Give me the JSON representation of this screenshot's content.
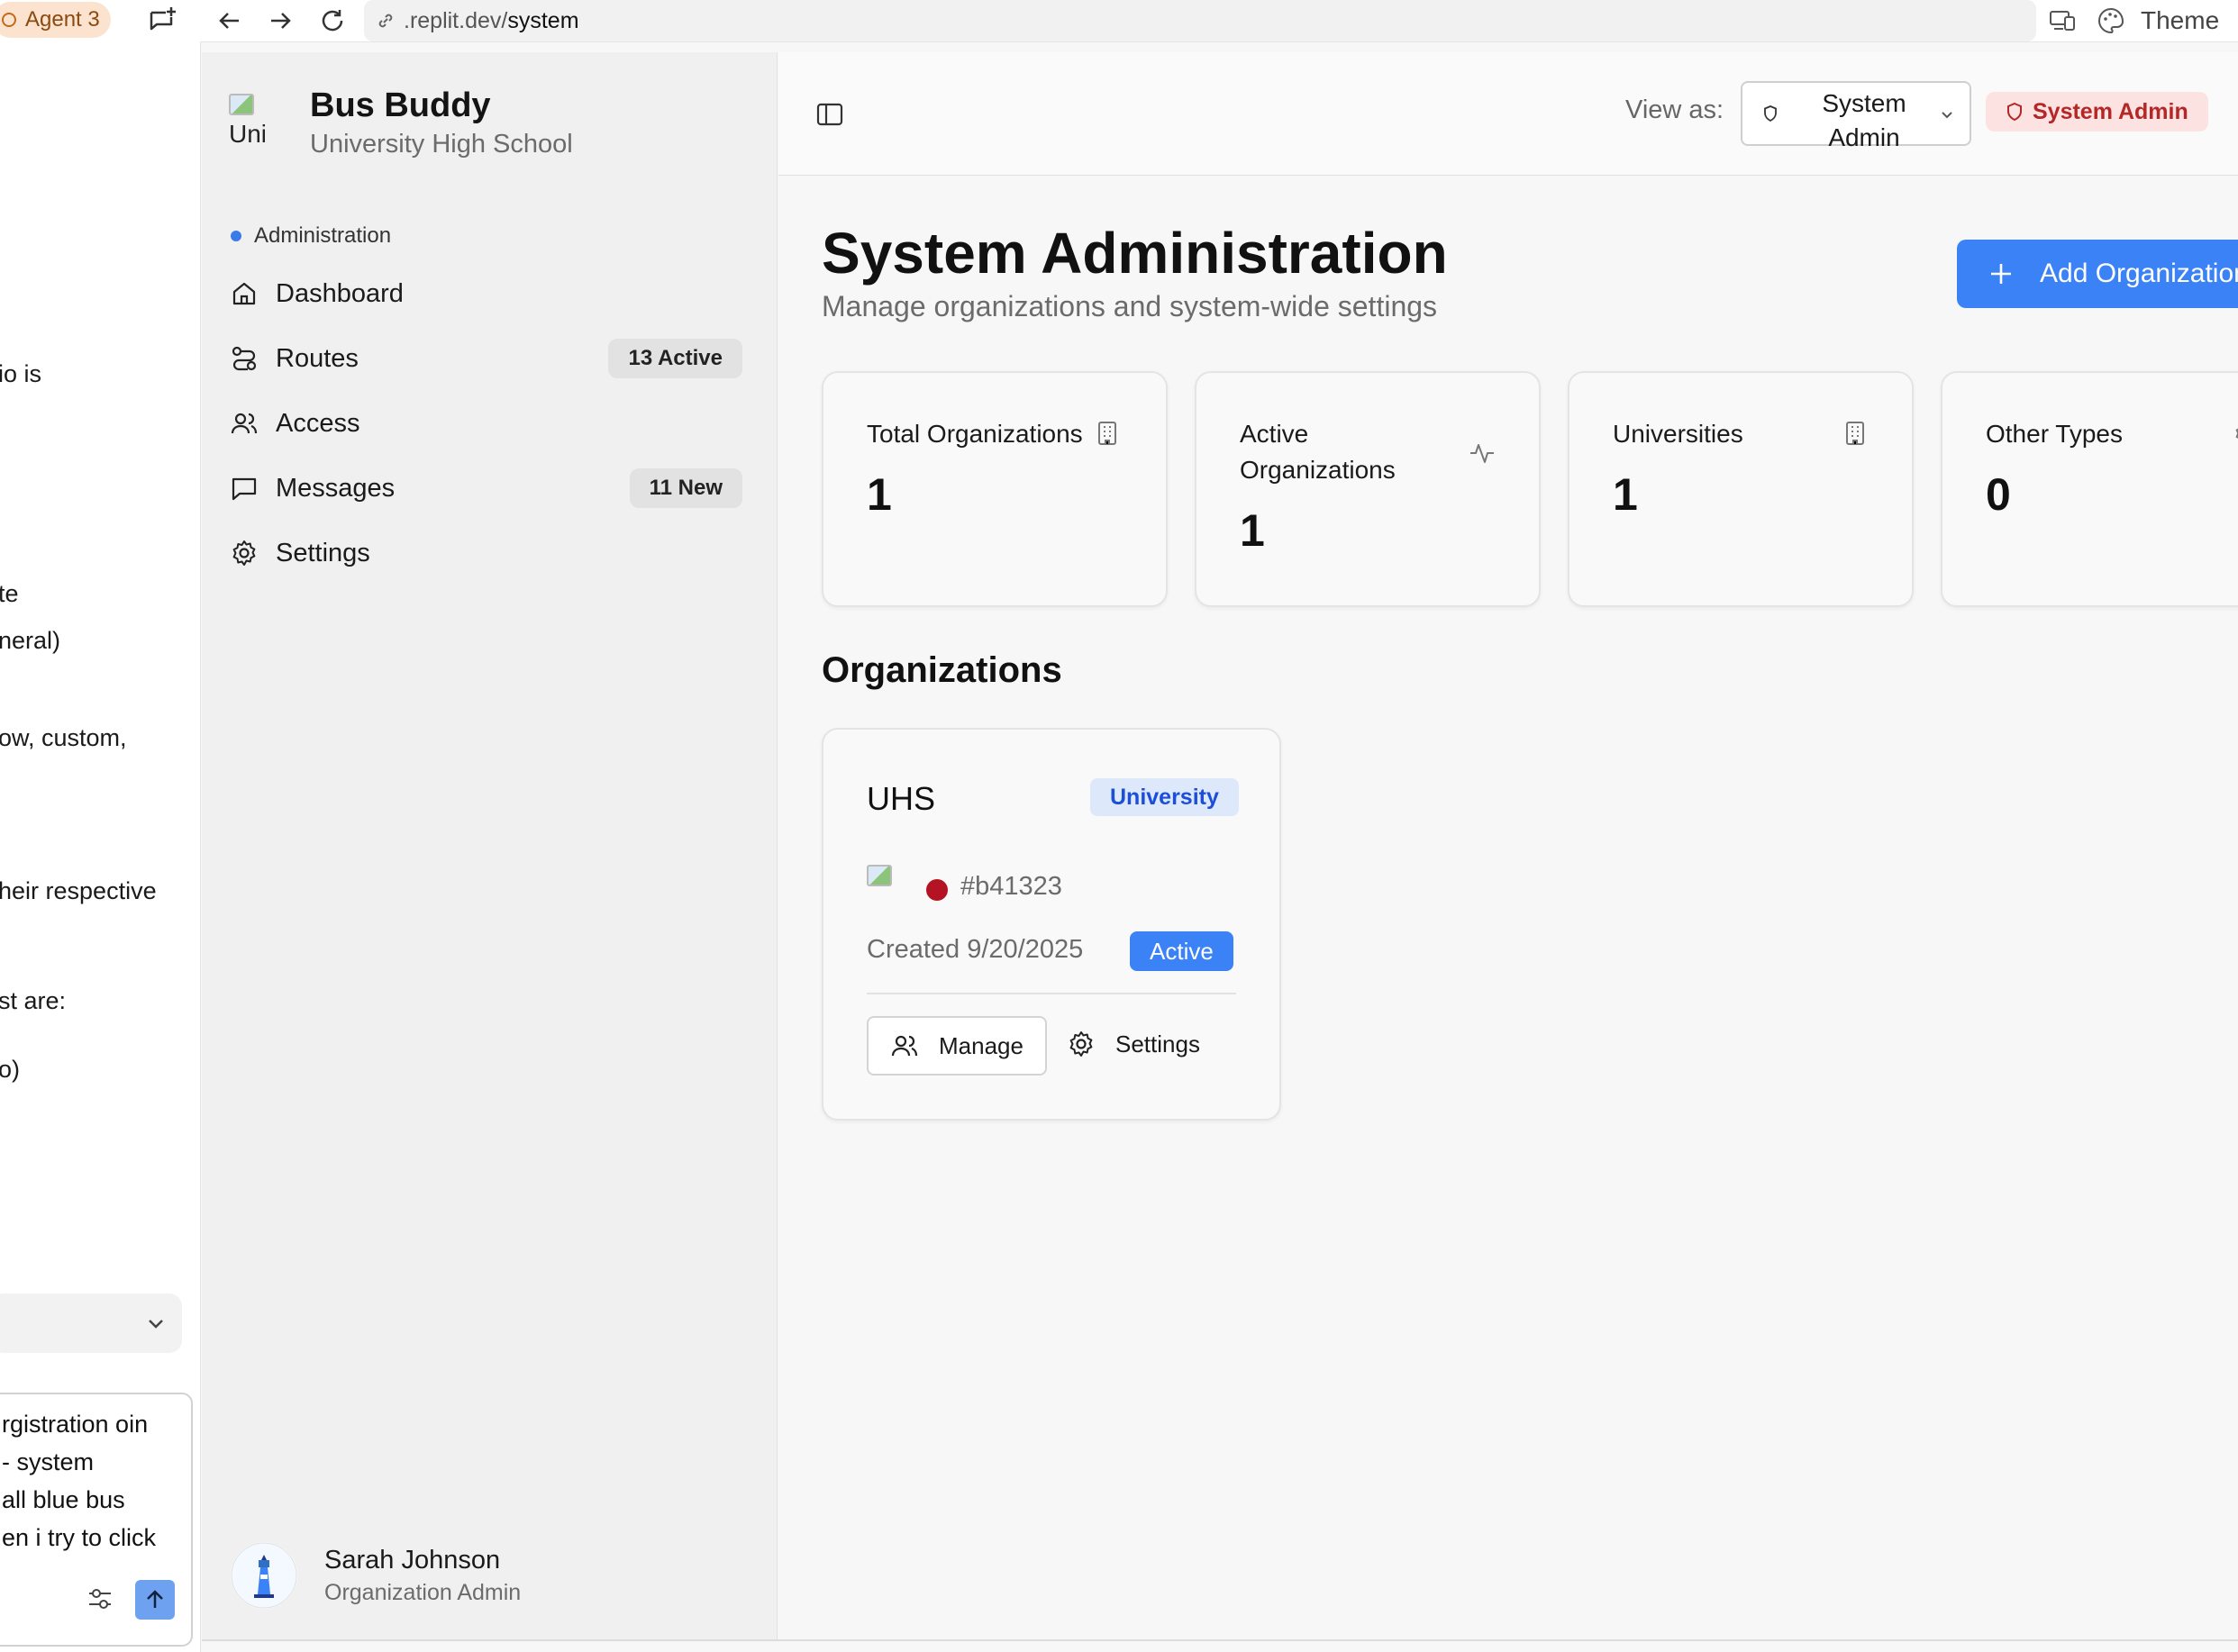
{
  "browser": {
    "agent_tab_label": "Agent 3",
    "url_prefix": ".replit.dev/",
    "url_path": "system",
    "theme_label": "Theme"
  },
  "agent_panel": {
    "text_fragments": [
      "io is",
      "te",
      "neral)",
      "ow, custom,",
      "heir respective",
      "st are:",
      "o)"
    ],
    "input_lines": [
      "rgistration oin",
      "- system",
      "all blue bus",
      "en i try to click"
    ],
    "send_button_color": "#6ea2f0"
  },
  "sidebar": {
    "logo_alt": "Univ",
    "app_name": "Bus Buddy",
    "school_name": "University High School",
    "section_label": "Administration",
    "items": [
      {
        "label": "Dashboard",
        "badge": "",
        "icon": "home-icon"
      },
      {
        "label": "Routes",
        "badge": "13 Active",
        "icon": "route-icon"
      },
      {
        "label": "Access",
        "badge": "",
        "icon": "users-icon"
      },
      {
        "label": "Messages",
        "badge": "11 New",
        "icon": "message-icon"
      },
      {
        "label": "Settings",
        "badge": "",
        "icon": "gear-icon"
      }
    ],
    "user": {
      "name": "Sarah Johnson",
      "role": "Organization Admin"
    }
  },
  "header": {
    "view_as_label": "View as:",
    "view_as_value": "System Admin",
    "role_badge": "System Admin"
  },
  "main": {
    "title": "System Administration",
    "subtitle": "Manage organizations and system-wide settings",
    "add_button": "Add Organization",
    "stats": [
      {
        "label": "Total Organizations",
        "value": "1",
        "icon": "building-icon"
      },
      {
        "label": "Active Organizations",
        "value": "1",
        "icon": "activity-icon"
      },
      {
        "label": "Universities",
        "value": "1",
        "icon": "building-icon"
      },
      {
        "label": "Other Types",
        "value": "0",
        "icon": "gear-icon"
      }
    ],
    "organizations_title": "Organizations",
    "organizations": [
      {
        "name": "UHS",
        "type": "University",
        "logo_alt": "UHS",
        "color": "#b41323",
        "color_label": "#b41323",
        "created": "Created 9/20/2025",
        "status": "Active",
        "manage_label": "Manage",
        "settings_label": "Settings"
      }
    ]
  },
  "colors": {
    "accent": "#3b82f6",
    "danger_bg": "#fde2e2",
    "danger_text": "#b32727",
    "badge_bg": "#dde9fb"
  }
}
